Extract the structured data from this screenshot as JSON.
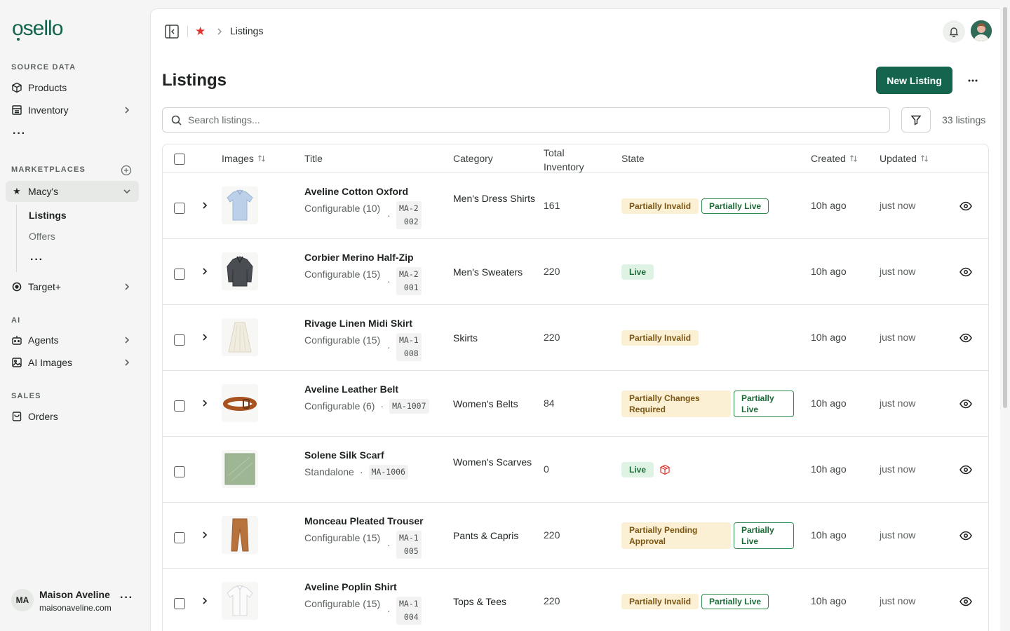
{
  "brand": {
    "name": "osello",
    "accent": "#15654e",
    "favorite_color": "#e3312b"
  },
  "sidebar": {
    "sections": {
      "source_data": "SOURCE DATA",
      "marketplaces": "MARKETPLACES",
      "ai": "AI",
      "sales": "SALES"
    },
    "items": {
      "products": "Products",
      "inventory": "Inventory",
      "macys": "Macy's",
      "listings": "Listings",
      "offers": "Offers",
      "target": "Target+",
      "agents": "Agents",
      "ai_images": "AI Images",
      "orders": "Orders"
    },
    "more": "···",
    "user": {
      "initials": "MA",
      "name": "Maison Aveline",
      "email": "maisonaveline.com"
    }
  },
  "topbar": {
    "breadcrumb": "Listings"
  },
  "page": {
    "title": "Listings",
    "new_button": "New Listing",
    "search_placeholder": "Search listings...",
    "count": "33 listings"
  },
  "table": {
    "headers": {
      "images": "Images",
      "title": "Title",
      "category": "Category",
      "inventory_1": "Total",
      "inventory_2": "Inventory",
      "state": "State",
      "created": "Created",
      "updated": "Updated"
    },
    "rows": [
      {
        "name": "Aveline Cotton Oxford",
        "type": "Configurable (10)",
        "sku": "MA-2002",
        "category": "Men's Dress Shirts",
        "inventory": "161",
        "states": [
          "Partially Invalid",
          "Partially Live"
        ],
        "created": "10h ago",
        "updated": "just now"
      },
      {
        "name": "Corbier Merino Half-Zip",
        "type": "Configurable (15)",
        "sku": "MA-2001",
        "category": "Men's Sweaters",
        "inventory": "220",
        "states": [
          "Live"
        ],
        "created": "10h ago",
        "updated": "just now"
      },
      {
        "name": "Rivage Linen Midi Skirt",
        "type": "Configurable (15)",
        "sku": "MA-1008",
        "category": "Skirts",
        "inventory": "220",
        "states": [
          "Partially Invalid"
        ],
        "created": "10h ago",
        "updated": "just now"
      },
      {
        "name": "Aveline Leather Belt",
        "type": "Configurable (6)",
        "sku": "MA-1007",
        "category": "Women's Belts",
        "inventory": "84",
        "states": [
          "Partially Changes Required",
          "Partially Live"
        ],
        "created": "10h ago",
        "updated": "just now"
      },
      {
        "name": "Solene Silk Scarf",
        "type": "Standalone",
        "sku": "MA-1006",
        "category": "Women's Scarves",
        "inventory": "0",
        "states": [
          "Live"
        ],
        "created": "10h ago",
        "updated": "just now"
      },
      {
        "name": "Monceau Pleated Trouser",
        "type": "Configurable (15)",
        "sku": "MA-1005",
        "category": "Pants & Capris",
        "inventory": "220",
        "states": [
          "Partially Pending Approval",
          "Partially Live"
        ],
        "created": "10h ago",
        "updated": "just now"
      },
      {
        "name": "Aveline Poplin Shirt",
        "type": "Configurable (15)",
        "sku": "MA-1004",
        "category": "Tops & Tees",
        "inventory": "220",
        "states": [
          "Partially Invalid",
          "Partially Live"
        ],
        "created": "10h ago",
        "updated": "just now"
      }
    ]
  }
}
